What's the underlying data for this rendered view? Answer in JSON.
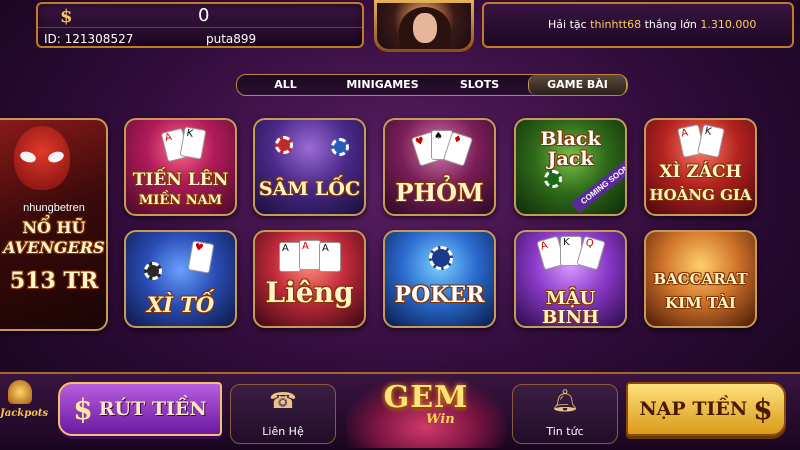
{
  "header": {
    "balance_icon": "dollar-icon",
    "balance": "0",
    "user_id": "ID: 121308527",
    "username": "puta899",
    "jackpot_notice": {
      "prefix": "Hải tặc",
      "name": "thinhtt68",
      "middle": "thắng lớn",
      "amount": "1.310.000"
    }
  },
  "tabs": [
    {
      "label": "ALL",
      "active": false
    },
    {
      "label": "MINIGAMES",
      "active": false
    },
    {
      "label": "SLOTS",
      "active": false
    },
    {
      "label": "GAME BÀI",
      "active": true
    }
  ],
  "featured": {
    "banner": "nhungbetren",
    "title": "NỔ HŨ",
    "subtitle": "AVENGERS",
    "amount": "513 TR"
  },
  "games": [
    {
      "line1": "TIẾN LÊN",
      "line2": "MIỀN NAM"
    },
    {
      "line1": "SÂM LỐC",
      "line2": ""
    },
    {
      "line1": "PHỎM",
      "line2": ""
    },
    {
      "line1": "Black Jack",
      "line2": "",
      "badge": "COMING SOON"
    },
    {
      "line1": "XÌ ZÁCH",
      "line2": "HOÀNG GIA"
    },
    {
      "line1": "XÌ TỐ",
      "line2": ""
    },
    {
      "line1": "Liêng",
      "line2": ""
    },
    {
      "line1": "POKER",
      "line2": ""
    },
    {
      "line1": "MẬU BINH",
      "line2": ""
    },
    {
      "line1": "BACCARAT",
      "line2": "KIM TÀI"
    }
  ],
  "bottom": {
    "jackpots_label": "Jackpots",
    "withdraw_label": "RÚT TIỀN",
    "deposit_label": "NẠP TIỀN",
    "contact_label": "Liên Hệ",
    "news_label": "Tin tức",
    "logo_main": "GEM",
    "logo_sub": "Win",
    "contact_icon": "phone-icon",
    "news_icon": "bell-icon"
  },
  "colors": {
    "accent_gold": "#f5d35a",
    "frame_gold": "#c07a2a",
    "background": "#2e0b38"
  }
}
